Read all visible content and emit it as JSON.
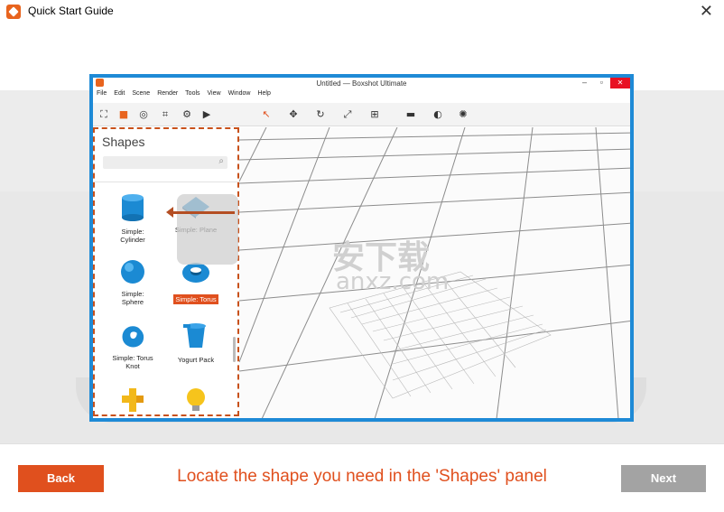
{
  "window": {
    "title": "Quick Start Guide",
    "close_glyph": "✕"
  },
  "app": {
    "title": "Untitled — Boxshot Ultimate",
    "menu": [
      "File",
      "Edit",
      "Scene",
      "Render",
      "Tools",
      "View",
      "Window",
      "Help"
    ],
    "toolbar_icons": [
      "hierarchy-icon",
      "cube-icon",
      "sphere-pattern-icon",
      "frame-icon",
      "gear-icon",
      "camera-icon",
      "select-arrow-icon",
      "move-icon",
      "rotate-icon",
      "scale-icon",
      "fit-icon",
      "clapper-icon",
      "camera-flip-icon",
      "light-icon"
    ],
    "shapes_panel": {
      "title": "Shapes",
      "items": [
        {
          "label": "Simple:\nCylinder",
          "icon": "cylinder-icon"
        },
        {
          "label": "Simple: Plane",
          "icon": "plane-icon"
        },
        {
          "label": "Simple:\nSphere",
          "icon": "sphere-icon"
        },
        {
          "label": "Simple: Torus",
          "icon": "torus-icon",
          "selected": true
        },
        {
          "label": "Simple: Torus\nKnot",
          "icon": "torus-knot-icon"
        },
        {
          "label": "Yogurt Pack",
          "icon": "yogurt-pack-icon"
        },
        {
          "label": "",
          "icon": "cross-shape-icon"
        },
        {
          "label": "",
          "icon": "bulb-icon"
        }
      ]
    }
  },
  "watermark": {
    "text_cn": "安下载",
    "text_en": "anxz.com"
  },
  "footer": {
    "back_label": "Back",
    "instruction": "Locate the shape you need in the 'Shapes' panel",
    "next_label": "Next"
  },
  "colors": {
    "accent": "#e0501e",
    "next_disabled": "#a3a3a3",
    "app_border": "#1e8ad6"
  }
}
